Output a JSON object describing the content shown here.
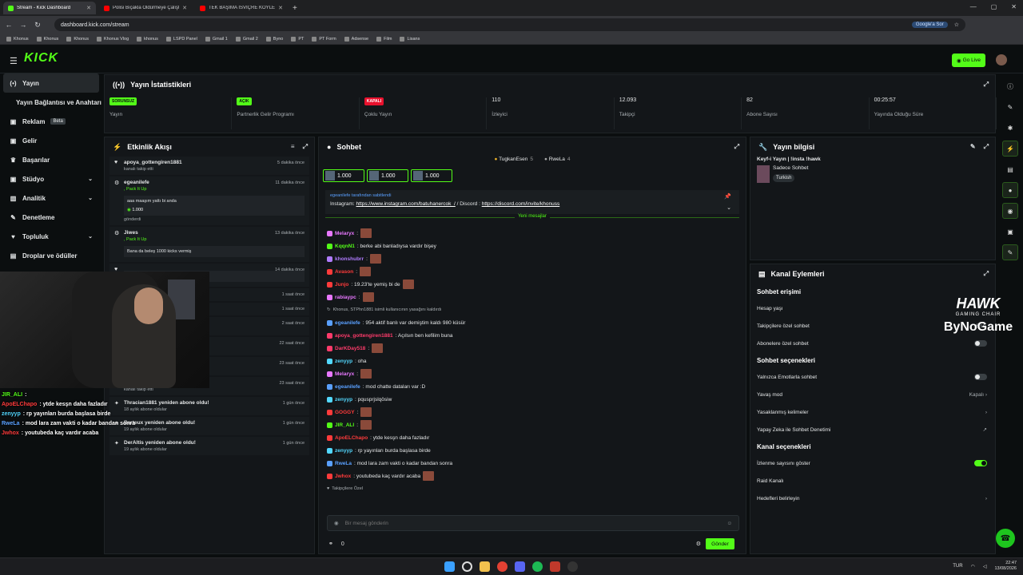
{
  "browser": {
    "tabs": [
      {
        "label": "Stream - Kick Dashboard",
        "color": "#53fc18",
        "active": true
      },
      {
        "label": "Polisi Bıçakla Öldürmeye Çalıştı",
        "color": "#ff0000",
        "active": false
      },
      {
        "label": "TEK BAŞIMA İSVİÇRE KÖYLERİN",
        "color": "#ff0000",
        "active": false
      }
    ],
    "url": "dashboard.kick.com/stream",
    "google_label": "Google'a Sor",
    "bookmarks": [
      "Khonus",
      "Khonus",
      "Khonus",
      "Khonus Vlog",
      "khonus",
      "LSPD Panel",
      "Gmail 1",
      "Gmail 2",
      "Byno",
      "PT",
      "PT Form",
      "Adsense",
      "Film",
      "Lisans"
    ]
  },
  "topnav": {
    "logo": "KICK",
    "go_live": "Go Live"
  },
  "sidebar": {
    "items": [
      {
        "icon": "(•)",
        "label": "Yayın",
        "active": true
      },
      {
        "icon": "",
        "label": "Yayın Bağlantısı ve Anahtarı"
      },
      {
        "icon": "▣",
        "label": "Reklam",
        "badge": "Beta"
      },
      {
        "icon": "▣",
        "label": "Gelir"
      },
      {
        "icon": "♛",
        "label": "Başarılar"
      },
      {
        "icon": "▣",
        "label": "Stüdyo",
        "chevron": true
      },
      {
        "icon": "▥",
        "label": "Analitik",
        "chevron": true
      },
      {
        "icon": "✎",
        "label": "Denetleme"
      },
      {
        "icon": "♥",
        "label": "Topluluk",
        "chevron": true
      },
      {
        "icon": "▤",
        "label": "Droplar ve ödüller"
      }
    ]
  },
  "stats": {
    "title": "Yayın İstatistikleri",
    "cells": [
      {
        "pill": "SORUNSUZ",
        "pill_color": "#53fc18",
        "label": "Yayın"
      },
      {
        "pill": "AÇIK",
        "pill_color": "#53fc18",
        "label": "Partnerlik Gelir Programı"
      },
      {
        "pill": "KAPALI",
        "pill_color": "#e8112d",
        "label": "Çoklu Yayın"
      },
      {
        "value": "110",
        "label": "İzleyici"
      },
      {
        "value": "12.093",
        "label": "Takipçi"
      },
      {
        "value": "82",
        "label": "Abone Sayısı"
      },
      {
        "value": "00:25:57",
        "label": "Yayında Olduğu Süre"
      }
    ]
  },
  "activity": {
    "title": "Etkinlik Akışı",
    "events": [
      {
        "name": "apoya_gottengiren1881",
        "sub": "kanalı takip etti",
        "ago": "5 dakika önce"
      },
      {
        "name": "egeanilefe",
        "pack": ", Pack It Up",
        "box": "aaa maaşım yattı bi anda",
        "kicks": "1.000",
        "sub": "gönderdi",
        "ago": "11 dakika önce"
      },
      {
        "name": "Jiwes",
        "pack": ", Pack It Up",
        "box": "Bana da beleş 1000 kicks vermiş",
        "ago": "13 dakika önce"
      },
      {
        "name": "",
        "box": "com/batuhanercok_/ Discord :",
        "ago": "14 dakika önce"
      },
      {
        "name": "",
        "sub": "du!",
        "ago": "1 saat önce"
      },
      {
        "name": "",
        "sub": "kanalı takip etti",
        "ago": "1 saat önce"
      },
      {
        "name": "cmee3",
        "sub": "kanalı takip etti",
        "ago": "2 saat önce"
      },
      {
        "name": "hyebilliterken yeniden abone oldu!",
        "sub": "7 aylık abone oldular",
        "ago": "22 saat önce"
      },
      {
        "name": "berat9263",
        "sub": "kanalı takip etti",
        "ago": "23 saat önce"
      },
      {
        "name": "Zeynep6106",
        "sub": "kanalı takip etti",
        "ago": "23 saat önce"
      },
      {
        "name": "Thracian1881 yeniden abone oldu!",
        "sub": "18 aylık abone oldular",
        "ago": "1 gün önce"
      },
      {
        "name": "Barteux yeniden abone oldu!",
        "sub": "19 aylık abone oldular",
        "ago": "1 gün önce"
      },
      {
        "name": "DerAltis yeniden abone oldu!",
        "sub": "19 aylık abone oldular",
        "ago": "1 gün önce"
      }
    ]
  },
  "chat": {
    "title": "Sohbet",
    "top_users": [
      {
        "name": "TugkanEsen",
        "n": "5"
      },
      {
        "name": "RweLa",
        "n": "4"
      }
    ],
    "kick_boxes": [
      "1.000",
      "1.000",
      "1.000"
    ],
    "pinned_by": "egeanilefe tarafından sabitlendi",
    "pinned_text": "Instagram:",
    "pinned_link1": "https://www.instagram.com/batuhanercok_/",
    "pinned_mid": "/ Discord :",
    "pinned_link2": "https://discord.com/invite/khonuss",
    "new_messages": "Yeni mesajlar",
    "messages": [
      {
        "user": "Melaryx",
        "color": "#e878ff",
        "text": ":",
        "emote": true
      },
      {
        "user": "KqqnN1",
        "color": "#53fc18",
        "text": ": berke abi banladıysa vardır bişey"
      },
      {
        "user": "khonshubrr",
        "color": "#b07cff",
        "text": ":",
        "emote": true
      },
      {
        "user": "Avason",
        "color": "#ff3b3b",
        "text": ":",
        "emote": true
      },
      {
        "user": "Junjo",
        "color": "#ff3b3b",
        "text": ": 19.23'te yemiş bi de",
        "emote": true
      },
      {
        "user": "rabiaypc",
        "color": "#e878ff",
        "text": ":",
        "emote": true
      },
      {
        "system": "Khonus, STPhn1881 isimli kullanıcının yasağını kaldırdı"
      },
      {
        "user": "egeanilefe",
        "color": "#5aa0ff",
        "text": ": 954 aktif banlı var demiştim kaldı 980 küsür"
      },
      {
        "user": "apoya_gottengiren1881",
        "color": "#ff3b6b",
        "text": ": Açılsın ben kefilim buna"
      },
      {
        "user": "DarKDay518",
        "color": "#ff3b6b",
        "text": ":",
        "emote": true
      },
      {
        "user": "zenyyp",
        "color": "#53d8ff",
        "text": ": oha"
      },
      {
        "user": "Melaryx",
        "color": "#e878ff",
        "text": ":",
        "emote": true
      },
      {
        "user": "egeanilefe",
        "color": "#5aa0ff",
        "text": ": mod chatte dataları var :D"
      },
      {
        "user": "zenyyp",
        "color": "#53d8ff",
        "text": ": pqusprjslqösiw"
      },
      {
        "user": "GOGGY",
        "color": "#ff3b3b",
        "text": ":",
        "emote": true
      },
      {
        "user": "JIR_ALI",
        "color": "#53fc18",
        "text": ":",
        "emote": true
      },
      {
        "user": "ApoELChapo",
        "color": "#ff3b3b",
        "text": ": ytde kesşn daha fazladır"
      },
      {
        "user": "zenyyp",
        "color": "#53d8ff",
        "text": ": rp yayınları burda başlasa birde"
      },
      {
        "user": "RweLa",
        "color": "#5aa0ff",
        "text": ": mod lara zam vakti o kadar bandan sonra"
      },
      {
        "user": "Jwhox",
        "color": "#ff3b3b",
        "text": ": youtubeda kaç vardır acaba",
        "emote": true
      }
    ],
    "followers_only": "Takipçilere Özel",
    "placeholder": "Bir mesaj gönderin",
    "points": "0",
    "send": "Gönder"
  },
  "streaminfo": {
    "title": "Yayın bilgisi",
    "stream_title": "Keyf-i Yayın | !insta !hawk",
    "category": "Sadece Sohbet",
    "tag": "Turkish"
  },
  "channel": {
    "title": "Kanal Eylemleri",
    "chat_access": "Sohbet erişimi",
    "account_age": "Hesap yaşı",
    "followers_only_chat": "Takipçilere özel sohbet",
    "followers_time": "6 sn.",
    "subscribers_only": "Abonelere özel sohbet",
    "chat_options": "Sohbet seçenekleri",
    "emotes_only": "Yalnızca Emotlarla sohbet",
    "slow_mode": "Yavaş mod",
    "slow_value": "Kapalı",
    "banned_words": "Yasaklanmış kelimeler",
    "ai_moderation": "Yapay Zeka ile Sohbet Denetimi",
    "channel_options": "Kanal seçenekleri",
    "show_viewers": "İzlenme sayısını göster",
    "raid": "Raid Kanalı",
    "goals": "Hedefleri belirleyin"
  },
  "overlay": {
    "chat": [
      {
        "user": "JIR_ALI",
        "color": "#53fc18",
        "text": ":"
      },
      {
        "user": "ApoELChapo",
        "color": "#ff3b3b",
        "text": ": ytde kesşn daha fazladır"
      },
      {
        "user": "zenyyp",
        "color": "#53d8ff",
        "text": ": rp yayınları burda başlasa birde"
      },
      {
        "user": "RweLa",
        "color": "#5aa0ff",
        "text": ": mod lara zam vakti o kadar bandan sonra"
      },
      {
        "user": "Jwhox",
        "color": "#ff3b3b",
        "text": ": youtubeda kaç vardır acaba"
      }
    ],
    "hawk": "HAWK",
    "hawk_sub": "GAMING CHAIR",
    "byno": "ByNoGame"
  },
  "taskbar": {
    "lang": "TUR",
    "time": "22:47",
    "date": "13/08/2026"
  }
}
